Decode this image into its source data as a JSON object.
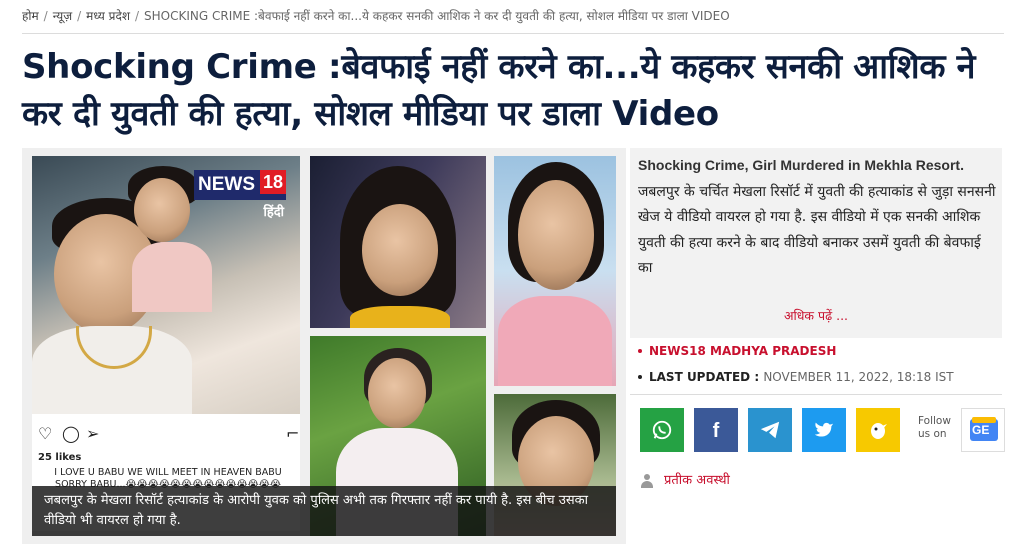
{
  "breadcrumb": {
    "items": [
      "होम",
      "न्यूज़",
      "मध्य प्रदेश"
    ],
    "current": "SHOCKING CRIME :बेवफाई नहीं करने का...ये कहकर सनकी आशिक ने कर दी युवती की हत्या, सोशल मीडिया पर डाला VIDEO",
    "separator": "/"
  },
  "headline": "Shocking Crime :बेवफाई नहीं करने का...ये कहकर सनकी आशिक ने कर दी युवती की हत्या, सोशल मीडिया पर डाला Video",
  "media": {
    "logo": {
      "brand": "NEWS",
      "number": "18",
      "lang": "हिंदी"
    },
    "instagram": {
      "likes": "25 likes",
      "caption": "I LOVE U BABU WE WILL MEET IN HEAVEN BABU SORRY BABU...😭😭😭😭😭😭😭😭😭😭😭😭😭😭",
      "icons": [
        "heart-icon",
        "comment-icon",
        "send-icon",
        "bookmark-icon"
      ]
    },
    "caption": "जबलपुर के मेखला रिसॉर्ट हत्याकांड के आरोपी युवक को पुलिस अभी तक गिरफ्तार नहीं कर पायी है. इस बीच उसका वीडियो भी वायरल हो गया है."
  },
  "summary": {
    "lead_en": "Shocking Crime, Girl Murdered in Mekhla Resort.",
    "text": " जबलपुर के चर्चित मेखला रिसॉर्ट में युवती की हत्याकांड से जुड़ा सनसनी खेज ये वीडियो वायरल हो गया है. इस वीडियो में एक सनकी आशिक युवती की हत्या करने के बाद वीडियो बनाकर उसमें युवती की बेवफाई का",
    "more": "अधिक पढ़ें ..."
  },
  "meta": {
    "source": "NEWS18 MADHYA PRADESH",
    "updated_label": "LAST UPDATED :",
    "updated_value": "NOVEMBER 11, 2022, 18:18 IST"
  },
  "share": {
    "buttons": [
      {
        "name": "whatsapp",
        "icon": "whatsapp-icon",
        "color": "#25a244"
      },
      {
        "name": "facebook",
        "icon": "facebook-icon",
        "color": "#3b5998"
      },
      {
        "name": "telegram",
        "icon": "telegram-icon",
        "color": "#2a93cf"
      },
      {
        "name": "twitter",
        "icon": "twitter-icon",
        "color": "#1d9bf0"
      },
      {
        "name": "koo",
        "icon": "koo-icon",
        "color": "#f7c900"
      }
    ],
    "follow_line1": "Follow",
    "follow_line2": "us on",
    "google_news_label": "GE"
  },
  "author": "प्रतीक अवस्थी",
  "colors": {
    "accent": "#c8102e",
    "headline": "#0d1e3d"
  }
}
